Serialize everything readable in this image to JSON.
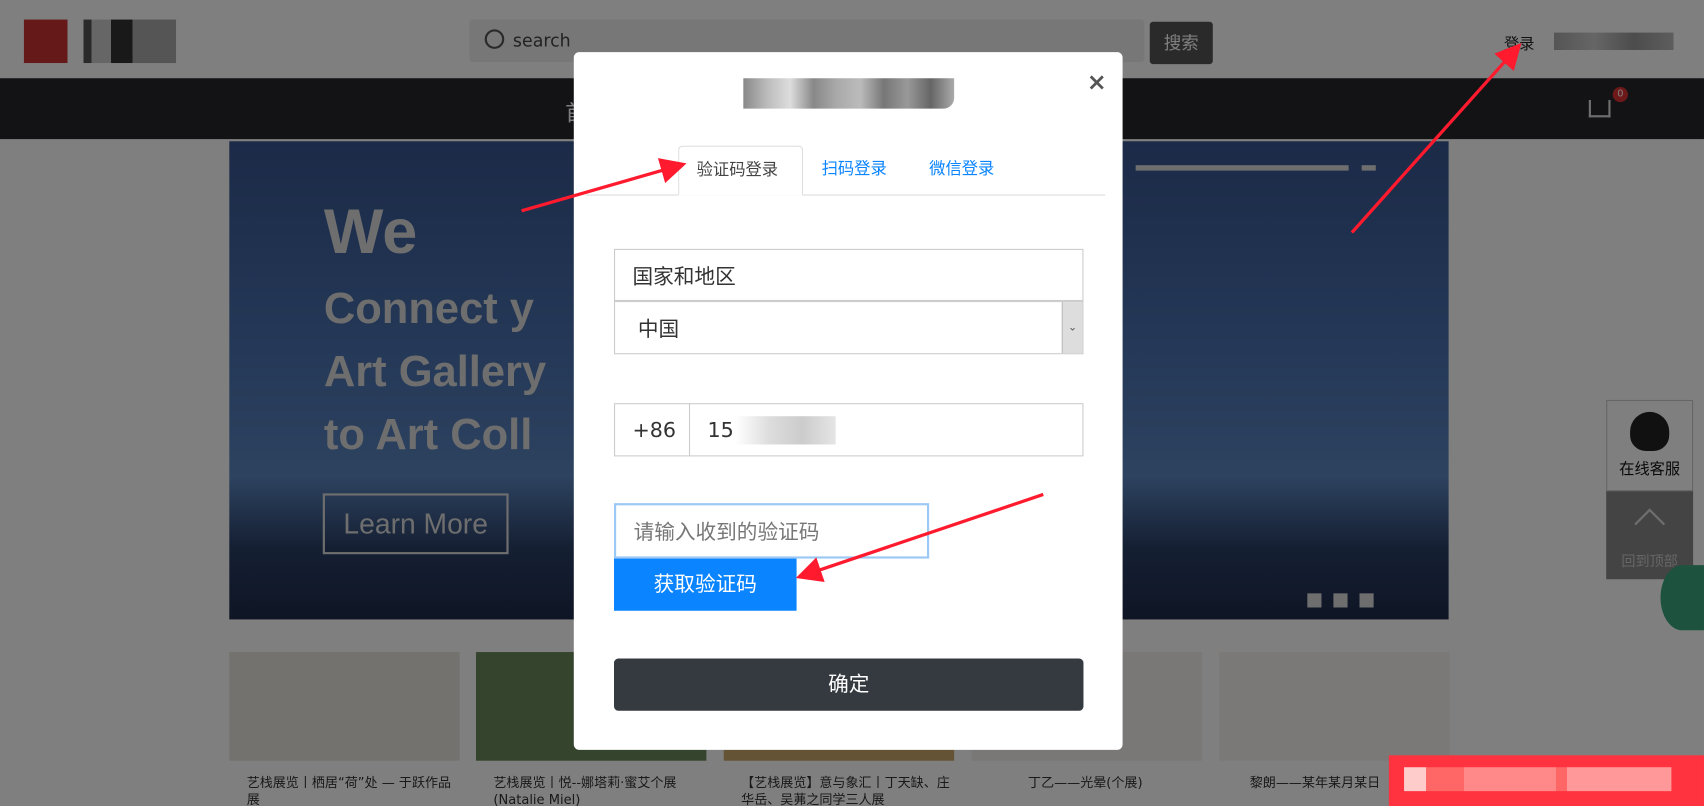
{
  "header": {
    "search_placeholder": "search",
    "search_button": "搜索",
    "login": "登录"
  },
  "nav": {
    "home": "首页",
    "cart_count": "0"
  },
  "banner": {
    "line1": "We",
    "line2": "Connect y",
    "line3": "Art Gallery",
    "line4": "to Art Coll",
    "button": "Learn More"
  },
  "exhibitions": [
    {
      "caption": "艺栈展览丨栖居“荷”处 — 于跃作品展"
    },
    {
      "caption": "艺栈展览丨悦--娜塔莉·蜜艾个展(Natalie Miel)"
    },
    {
      "caption": "【艺栈展览】意与象汇丨丁天缺、庄华岳、吴茀之同学三人展"
    },
    {
      "caption": "丁乙——光晕(个展)"
    },
    {
      "caption": "黎朗——某年某月某日"
    }
  ],
  "side": {
    "service": "在线客服",
    "top": "回到顶部"
  },
  "modal": {
    "close": "×",
    "tabs": [
      {
        "label": "验证码登录",
        "active": true
      },
      {
        "label": "扫码登录"
      },
      {
        "label": "微信登录"
      }
    ],
    "country_label": "国家和地区",
    "country_value": "中国",
    "phone_prefix": "+86",
    "phone_value": "15",
    "code_placeholder": "请输入收到的验证码",
    "get_code": "获取验证码",
    "confirm": "确定"
  },
  "colors": {
    "accent": "#0a84ff",
    "confirm": "#343a40",
    "annotation": "#ff1a2e"
  }
}
